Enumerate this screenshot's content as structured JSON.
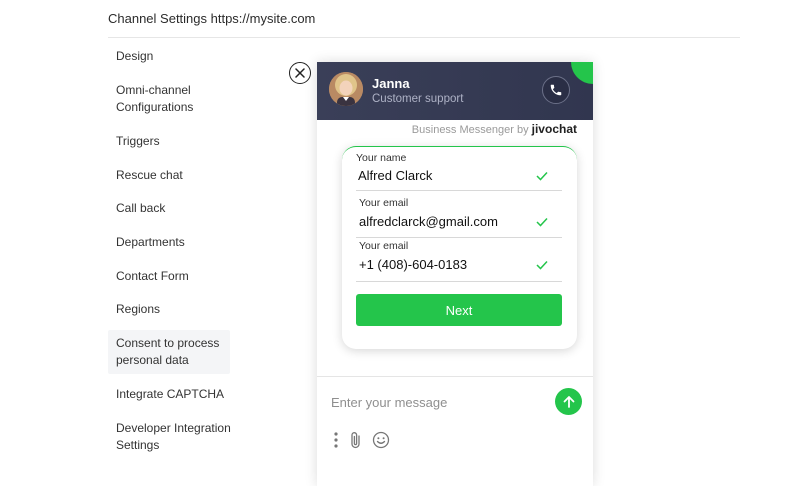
{
  "header": {
    "title": "Channel Settings https://mysite.com"
  },
  "sidebar": {
    "items": [
      {
        "label": "Design"
      },
      {
        "label": "Omni-channel Configurations"
      },
      {
        "label": "Triggers"
      },
      {
        "label": "Rescue chat"
      },
      {
        "label": "Call back"
      },
      {
        "label": "Departments"
      },
      {
        "label": "Contact Form"
      },
      {
        "label": "Regions"
      },
      {
        "label": "Consent to process personal data",
        "active": true
      },
      {
        "label": "Integrate CAPTCHA"
      },
      {
        "label": "Developer Integration Settings"
      }
    ]
  },
  "widget": {
    "agent_name": "Janna",
    "agent_role": "Customer support",
    "branding_text": "Business Messenger by",
    "brand_name": "jivochat",
    "form": {
      "fields": [
        {
          "label": "Your name",
          "value": "Alfred Clarck"
        },
        {
          "label": "Your email",
          "value": "alfredclarck@gmail.com"
        },
        {
          "label": "Your email",
          "value": "+1 (408)-604-0183"
        }
      ],
      "next_label": "Next"
    },
    "message_placeholder": "Enter your message"
  },
  "colors": {
    "accent_green": "#24c54b",
    "header_bg": "#363b54",
    "text": "#333333"
  }
}
